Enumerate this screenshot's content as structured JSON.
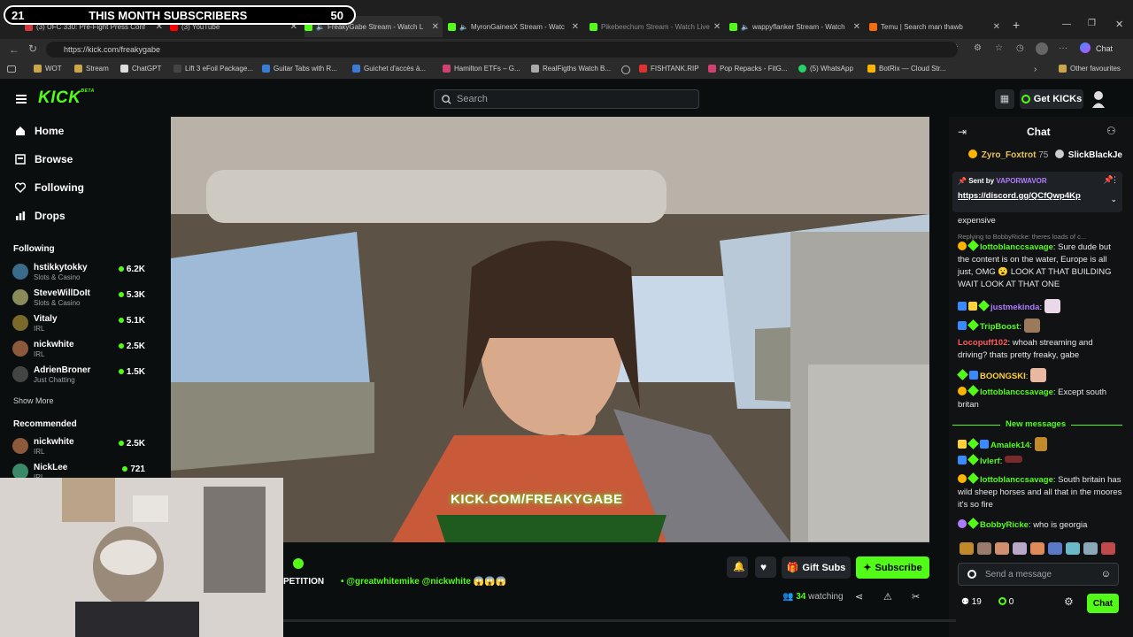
{
  "overlay": {
    "left": "21",
    "title": "THIS MONTH SUBSCRIBERS",
    "right": "50"
  },
  "tabs": [
    {
      "label": "(3) UFC 330: Pre-Fight Press Conf",
      "color": "#d23b3b"
    },
    {
      "label": "(3) YouTube",
      "color": "#ff0000"
    },
    {
      "label": "FreakyGabe Stream - Watch L",
      "color": "#53fc18"
    },
    {
      "label": "MyronGainesX Stream - Watc",
      "color": "#53fc18"
    },
    {
      "label": "Pikebeechum Stream - Watch Live",
      "color": "#53fc18"
    },
    {
      "label": "wappyflanker Stream - Watch",
      "color": "#53fc18"
    },
    {
      "label": "Temu | Search man thawb",
      "color": "#f46d10"
    }
  ],
  "address": "https://kick.com/freakygabe",
  "browser_chat_label": "Chat",
  "bookmarks": [
    "WOT",
    "Stream",
    "ChatGPT",
    "Lift 3 eFoil Package...",
    "Guitar Tabs with R...",
    "Guichet d'accès à...",
    "Hamilton ETFs – G...",
    "RealFigths Watch B...",
    "FISHTANK.RIP",
    "Pop Repacks - FitG...",
    "(5) WhatsApp",
    "BotRix — Cloud Str...",
    "Other favourites"
  ],
  "logo": "KICK",
  "logo_beta": "BETA",
  "search_placeholder": "Search",
  "get_kicks": "Get KICKs",
  "nav": {
    "home": "Home",
    "browse": "Browse",
    "following": "Following",
    "drops": "Drops"
  },
  "following_title": "Following",
  "following": [
    {
      "name": "hstikkytokky",
      "category": "Slots & Casino",
      "viewers": "6.2K",
      "color": "#3a6b8a"
    },
    {
      "name": "SteveWillDoIt",
      "category": "Slots & Casino",
      "viewers": "5.3K",
      "color": "#8a8a5a"
    },
    {
      "name": "Vitaly",
      "category": "IRL",
      "viewers": "5.1K",
      "color": "#7a6a2a"
    },
    {
      "name": "nickwhite",
      "category": "IRL",
      "viewers": "2.5K",
      "color": "#8a5a3a"
    },
    {
      "name": "AdrienBroner",
      "category": "Just Chatting",
      "viewers": "1.5K",
      "color": "#444444"
    }
  ],
  "show_more": "Show More",
  "recommended_title": "Recommended",
  "recommended": [
    {
      "name": "nickwhite",
      "category": "IRL",
      "viewers": "2.5K",
      "color": "#8a5a3a"
    },
    {
      "name": "NickLee",
      "category": "IRL",
      "viewers": "721",
      "color": "#3a8a6a"
    }
  ],
  "video_watermark": "KICK.COM/FREAKYGABE",
  "stream_title_fragment": "PETITION",
  "stream_mentions": "• @greatwhitemike @nickwhite 😱😱😱",
  "gift_subs": "Gift Subs",
  "subscribe": "Subscribe",
  "watching_count": "34",
  "watching_label": "watching",
  "chat": {
    "title": "Chat",
    "leaderboard": [
      {
        "name": "Zyro_Foxtrot",
        "count": "75"
      },
      {
        "name": "SlickBlackJe",
        "count": ""
      }
    ],
    "pinned_sent_by": "Sent by",
    "pinned_user": "VAPORWAVOR",
    "pinned_link": "https://discord.gg/QCfQwp4Kp",
    "expensive": "expensive",
    "reply_hint": "Replying to BobbyRicke: theres loads of c...",
    "messages": [
      {
        "user": "lottoblanccsavage",
        "color": "#53fc18",
        "text": "Sure dude but the content is on the water, Europe is all just, OMG 😮 LOOK AT THAT BUILDING WAIT LOOK AT THAT ONE"
      },
      {
        "user": "justmekinda",
        "color": "#b07cff",
        "text": ""
      },
      {
        "user": "TripBoost",
        "color": "#53fc18",
        "text": ""
      },
      {
        "user": "Locopuff102",
        "color": "#ff5a5a",
        "text": "whoah streaming and driving? thats pretty freaky, gabe"
      },
      {
        "user": "BOONGSKI",
        "color": "#ffd23c",
        "text": ""
      },
      {
        "user": "lottoblanccsavage",
        "color": "#53fc18",
        "text": "Except south britan"
      }
    ],
    "new_messages": "New messages",
    "messages2": [
      {
        "user": "Amalek14",
        "color": "#53fc18",
        "text": ""
      },
      {
        "user": "Ivlerf",
        "color": "#53fc18",
        "text": ""
      },
      {
        "user": "lottoblanccsavage",
        "color": "#53fc18",
        "text": "South britain has wild sheep horses and all that in the moores it's so fire"
      },
      {
        "user": "BobbyRicke",
        "color": "#53fc18",
        "text": "who is georgia"
      }
    ],
    "input_placeholder": "Send a message",
    "count_a": "19",
    "count_b": "0",
    "send_label": "Chat"
  }
}
